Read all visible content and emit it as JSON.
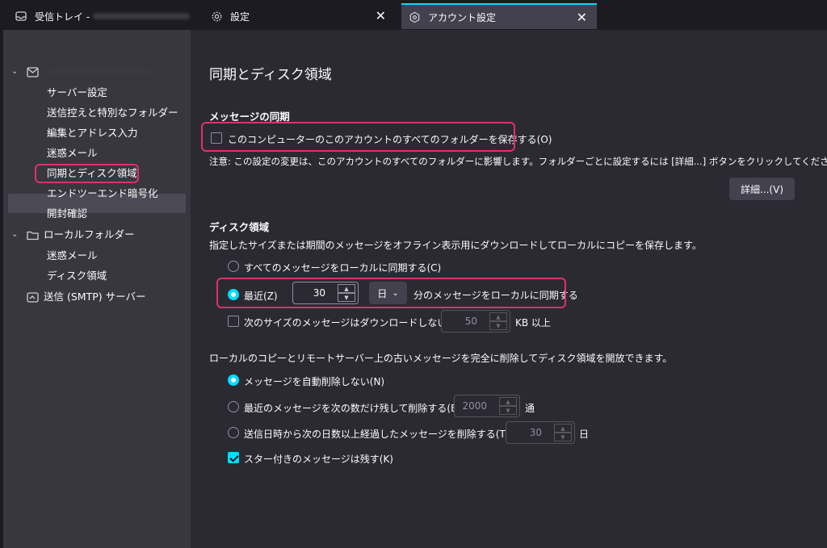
{
  "tabs": [
    {
      "label": "受信トレイ -",
      "icon": "inbox-icon",
      "blurred_account": true
    },
    {
      "label": "設定",
      "icon": "gear-icon",
      "close": "✕"
    },
    {
      "label": "アカウント設定",
      "icon": "account-settings-icon",
      "close": "✕",
      "active": true
    }
  ],
  "sidebar": {
    "account_chevron": "⌄",
    "items": [
      {
        "label": "サーバー設定"
      },
      {
        "label": "送信控えと特別なフォルダー"
      },
      {
        "label": "編集とアドレス入力"
      },
      {
        "label": "迷惑メール"
      },
      {
        "label": "同期とディスク領域",
        "selected": true
      },
      {
        "label": "エンドツーエンド暗号化"
      },
      {
        "label": "開封確認"
      }
    ],
    "local_folders": {
      "label": "ローカルフォルダー",
      "items": [
        {
          "label": "迷惑メール"
        },
        {
          "label": "ディスク領域"
        }
      ]
    },
    "smtp": {
      "label": "送信 (SMTP) サーバー"
    }
  },
  "main": {
    "title": "同期とディスク領域",
    "sync": {
      "heading": "メッセージの同期",
      "keep_all_label": "このコンピューターのこのアカウントのすべてのフォルダーを保存する(O)",
      "keep_all_checked": false,
      "note": "注意: この設定の変更は、このアカウントのすべてのフォルダーに影響します。フォルダーごとに設定するには [詳細...] ボタンをクリックしてください。",
      "advanced_button": "詳細...(V)"
    },
    "disk": {
      "heading": "ディスク領域",
      "description": "指定したサイズまたは期間のメッセージをオフライン表示用にダウンロードしてローカルにコピーを保存します。",
      "sync_all_label": "すべてのメッセージをローカルに同期する(C)",
      "recent_label": "最近(Z)",
      "recent_value": "30",
      "recent_unit": "日",
      "recent_suffix": "分のメッセージをローカルに同期する",
      "size_limit_label": "次のサイズのメッセージはダウンロードしない(M):",
      "size_limit_value": "50",
      "size_limit_unit": "KB 以上",
      "delete_description": "ローカルのコピーとリモートサーバー上の古いメッセージを完全に削除してディスク領域を開放できます。",
      "no_delete_label": "メッセージを自動削除しない(N)",
      "keep_recent_label": "最近のメッセージを次の数だけ残して削除する(B)",
      "keep_recent_value": "2000",
      "keep_recent_unit": "通",
      "delete_older_label": "送信日時から次の日数以上経過したメッセージを削除する(T)",
      "delete_older_value": "30",
      "delete_older_unit": "日",
      "keep_starred_label": "スター付きのメッセージは残す(K)",
      "keep_starred_checked": true
    }
  },
  "colors": {
    "accent": "#00ddff",
    "highlight": "#e0306a"
  }
}
